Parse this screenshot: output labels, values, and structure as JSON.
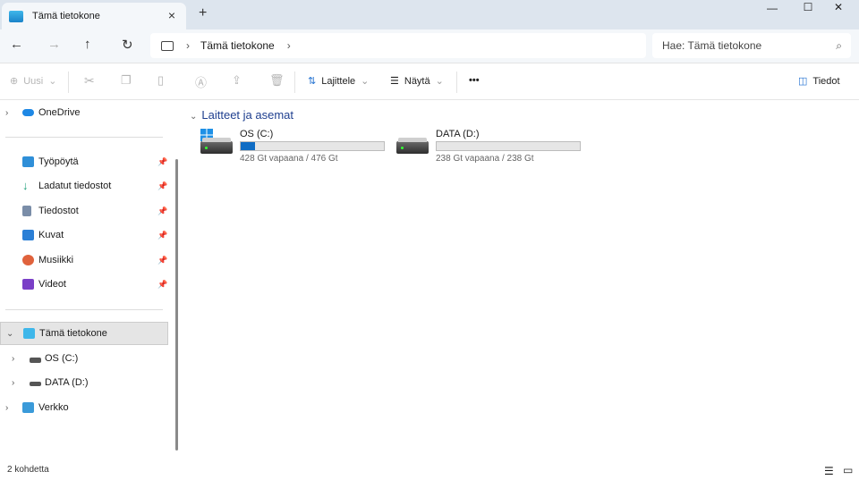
{
  "window": {
    "tab_title": "Tämä tietokone",
    "new_tab": "+",
    "close_tab": "×",
    "minimize": "—",
    "maximize": "☐",
    "close": "✕"
  },
  "address": {
    "breadcrumb": [
      "Tämä tietokone"
    ],
    "search_placeholder": "Hae: Tämä tietokone"
  },
  "toolbar": {
    "new": "Uusi",
    "sort": "Lajittele",
    "view": "Näytä",
    "more": "•••",
    "details": "Tiedot"
  },
  "sidebar": {
    "onedrive": "OneDrive",
    "quick": [
      {
        "label": "Työpöytä",
        "color": "#2f8fd8"
      },
      {
        "label": "Ladatut tiedostot",
        "color": "#1b9e77"
      },
      {
        "label": "Tiedostot",
        "color": "#7a8da8"
      },
      {
        "label": "Kuvat",
        "color": "#2b7fd6"
      },
      {
        "label": "Musiikki",
        "color": "#e0623c"
      },
      {
        "label": "Videot",
        "color": "#7a3fc7"
      }
    ],
    "this_pc": "Tämä tietokone",
    "drives": [
      "OS (C:)",
      "DATA (D:)"
    ],
    "network": "Verkko"
  },
  "content": {
    "group": "Laitteet ja asemat",
    "drives": [
      {
        "name": "OS (C:)",
        "free": "428 Gt vapaana / 476 Gt",
        "used_fraction": 0.101
      },
      {
        "name": "DATA (D:)",
        "free": "238 Gt vapaana / 238 Gt",
        "used_fraction": 0.0
      }
    ]
  },
  "status": {
    "count": "2 kohdetta"
  }
}
